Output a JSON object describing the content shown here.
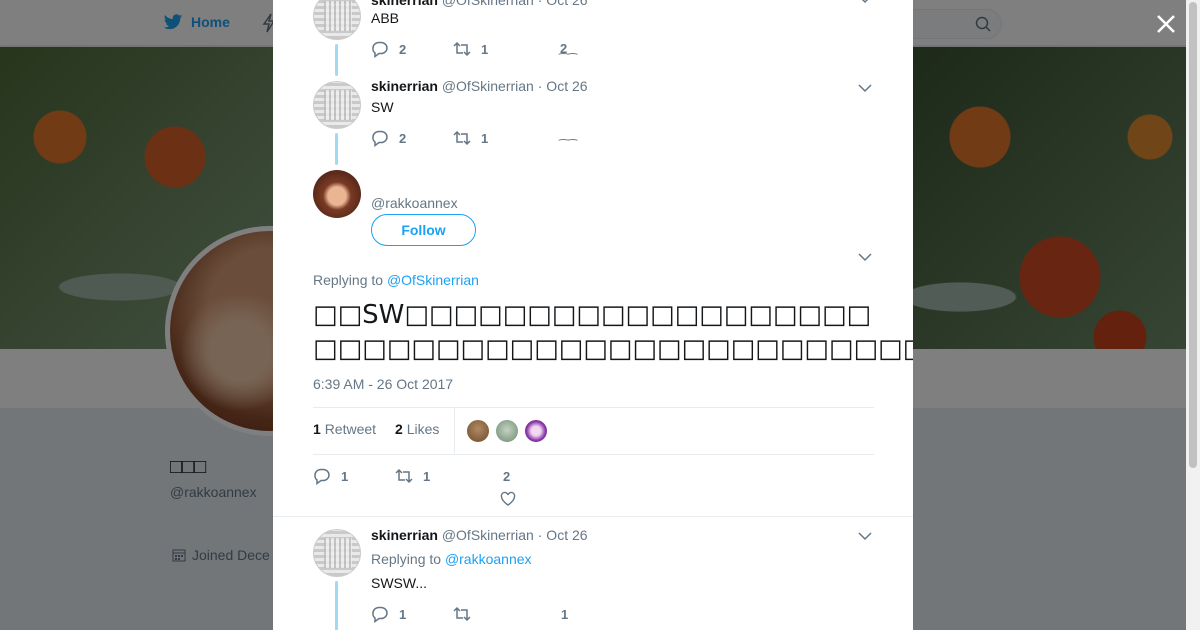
{
  "nav": {
    "home_label": "Home"
  },
  "profile": {
    "name": "□□□",
    "handle": "@rakkoannex",
    "joined": "Joined Dece"
  },
  "thread": [
    {
      "name": "skinerrian",
      "handle": "@OfSkinerrian",
      "date": "· Oct 26",
      "text": "ABB",
      "replies": "2",
      "retweets": "1",
      "likes": "2"
    },
    {
      "name": "skinerrian",
      "handle": "@OfSkinerrian",
      "date": "· Oct 26",
      "text": "SW",
      "replies": "2",
      "retweets": "1",
      "likes": ""
    }
  ],
  "main_tweet": {
    "handle": "@rakkoannex",
    "follow_label": "Follow",
    "replying_prefix": "Replying to ",
    "replying_handle": "@OfSkinerrian",
    "text_line1": "□□SW□□□□□□□□□□□□□□□□□□□",
    "text_line2": "□□□□□□□□□□□□□□□□□□□□□□□□□□□□□□□□□□□□□□□□□□□□□□□□□",
    "timestamp": "6:39 AM - 26 Oct 2017",
    "retweet_count": "1",
    "retweet_label": "Retweet",
    "like_count": "2",
    "like_label": "Likes",
    "replies": "1",
    "retweets": "1",
    "likes": "2"
  },
  "reply_tweet": {
    "name": "skinerrian",
    "handle": "@OfSkinerrian",
    "date": "· Oct 26",
    "replying_prefix": "Replying to ",
    "replying_handle": "@rakkoannex",
    "text": "SWSW...",
    "replies": "1",
    "likes": "1"
  },
  "colors": {
    "accent": "#1da1f2",
    "muted": "#657786",
    "thread_line": "#a4d9f5"
  },
  "icons": [
    "twitter-bird-icon",
    "search-icon",
    "close-icon",
    "reply-icon",
    "retweet-icon",
    "heart-icon",
    "chevron-down-icon",
    "calendar-icon"
  ]
}
